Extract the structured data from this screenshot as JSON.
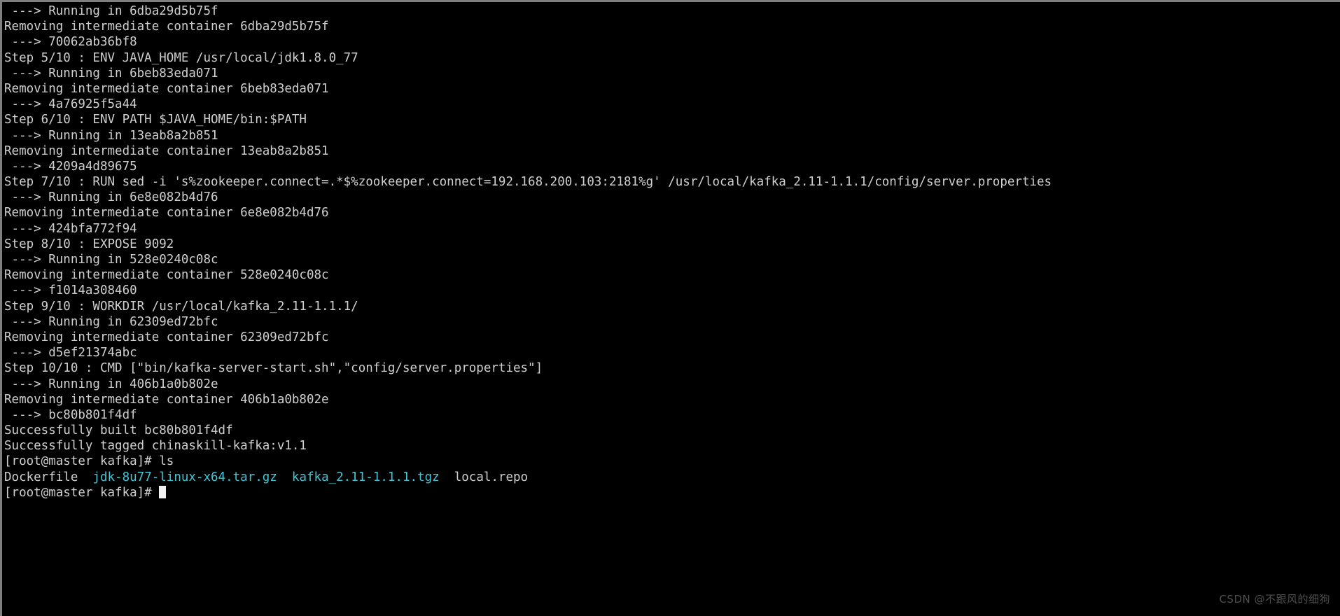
{
  "terminal": {
    "background_color": "#000000",
    "foreground_color": "#cfcfcf",
    "archive_color": "#3fc7d8",
    "border_color": "#7f7f7f",
    "cursor_color": "#f2f2f2",
    "prompt": "[root@master kafka]#",
    "lines": [
      {
        "text": " ---> Running in 6dba29d5b75f"
      },
      {
        "text": "Removing intermediate container 6dba29d5b75f"
      },
      {
        "text": " ---> 70062ab36bf8"
      },
      {
        "text": "Step 5/10 : ENV JAVA_HOME /usr/local/jdk1.8.0_77"
      },
      {
        "text": " ---> Running in 6beb83eda071"
      },
      {
        "text": "Removing intermediate container 6beb83eda071"
      },
      {
        "text": " ---> 4a76925f5a44"
      },
      {
        "text": "Step 6/10 : ENV PATH $JAVA_HOME/bin:$PATH"
      },
      {
        "text": " ---> Running in 13eab8a2b851"
      },
      {
        "text": "Removing intermediate container 13eab8a2b851"
      },
      {
        "text": " ---> 4209a4d89675"
      },
      {
        "text": "Step 7/10 : RUN sed -i 's%zookeeper.connect=.*$%zookeeper.connect=192.168.200.103:2181%g' /usr/local/kafka_2.11-1.1.1/config/server.properties"
      },
      {
        "text": " ---> Running in 6e8e082b4d76"
      },
      {
        "text": "Removing intermediate container 6e8e082b4d76"
      },
      {
        "text": " ---> 424bfa772f94"
      },
      {
        "text": "Step 8/10 : EXPOSE 9092"
      },
      {
        "text": " ---> Running in 528e0240c08c"
      },
      {
        "text": "Removing intermediate container 528e0240c08c"
      },
      {
        "text": " ---> f1014a308460"
      },
      {
        "text": "Step 9/10 : WORKDIR /usr/local/kafka_2.11-1.1.1/"
      },
      {
        "text": " ---> Running in 62309ed72bfc"
      },
      {
        "text": "Removing intermediate container 62309ed72bfc"
      },
      {
        "text": " ---> d5ef21374abc"
      },
      {
        "text": "Step 10/10 : CMD [\"bin/kafka-server-start.sh\",\"config/server.properties\"]"
      },
      {
        "text": " ---> Running in 406b1a0b802e"
      },
      {
        "text": "Removing intermediate container 406b1a0b802e"
      },
      {
        "text": " ---> bc80b801f4df"
      },
      {
        "text": "Successfully built bc80b801f4df"
      },
      {
        "text": "Successfully tagged chinaskill-kafka:v1.1"
      },
      {
        "text": "[root@master kafka]# ls"
      }
    ],
    "ls_output": {
      "entries": [
        {
          "name": "Dockerfile",
          "type": "file"
        },
        {
          "name": "jdk-8u77-linux-x64.tar.gz",
          "type": "archive"
        },
        {
          "name": "kafka_2.11-1.1.1.tgz",
          "type": "archive"
        },
        {
          "name": "local.repo",
          "type": "file"
        }
      ],
      "separator": "  "
    },
    "final_prompt": "[root@master kafka]# "
  },
  "watermark": {
    "text": "CSDN @不跟风的细狗"
  }
}
